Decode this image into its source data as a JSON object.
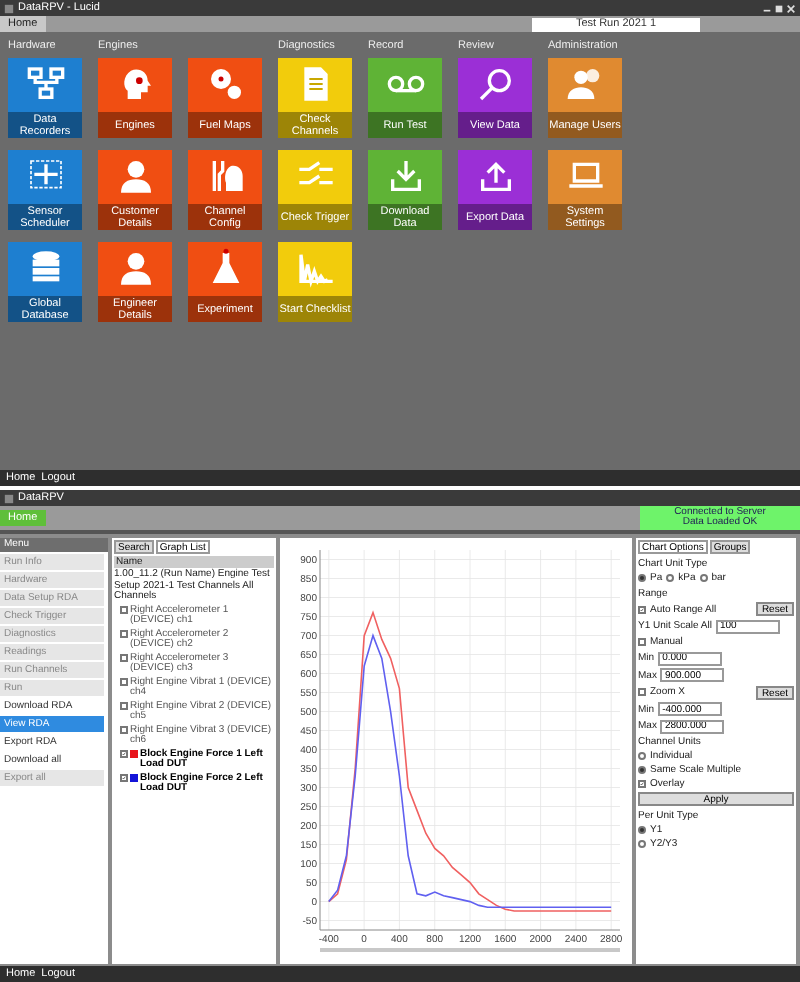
{
  "top_window": {
    "title": "DataRPV - Lucid",
    "tabs": [
      {
        "label": "Home",
        "selected": true
      }
    ],
    "search": {
      "value": "Test Run 2021 1"
    },
    "sections": [
      {
        "title": "Hardware",
        "tiles": [
          {
            "label": "Data Recorders",
            "color": "#1e7fd0"
          },
          {
            "label": "Sensor Scheduler",
            "color": "#1e7fd0"
          },
          {
            "label": "Global Database",
            "color": "#1e7fd0"
          }
        ]
      },
      {
        "title": "Engines",
        "tiles": [
          {
            "label": "Engines",
            "color": "#f04e12"
          },
          {
            "label": "Fuel Maps",
            "color": "#f04e12"
          },
          {
            "label": "Customer Details",
            "color": "#f04e12"
          },
          {
            "label": "Channel Config",
            "color": "#f04e12"
          },
          {
            "label": "Engineer Details",
            "color": "#f04e12"
          },
          {
            "label": "Experiment",
            "color": "#f04e12"
          }
        ]
      },
      {
        "title": "Diagnostics",
        "tiles": [
          {
            "label": "Check Channels",
            "color": "#f2cc0c"
          },
          {
            "label": "Check Trigger",
            "color": "#f2cc0c"
          },
          {
            "label": "Start Checklist",
            "color": "#f2cc0c"
          }
        ]
      },
      {
        "title": "Record",
        "tiles": [
          {
            "label": "Run Test",
            "color": "#5fb336"
          },
          {
            "label": "Download Data",
            "color": "#5fb336"
          }
        ]
      },
      {
        "title": "Review",
        "tiles": [
          {
            "label": "View Data",
            "color": "#9b2fd6"
          },
          {
            "label": "Export Data",
            "color": "#9b2fd6"
          }
        ]
      },
      {
        "title": "Administration",
        "tiles": [
          {
            "label": "Manage Users",
            "color": "#e08a30"
          },
          {
            "label": "System Settings",
            "color": "#e08a30"
          }
        ]
      }
    ],
    "status_bar": [
      "Home",
      "Logout"
    ]
  },
  "bottom_window": {
    "title": "DataRPV",
    "tabs": [
      {
        "label": "Home",
        "selected": true
      }
    ],
    "status_lines": [
      "Connected to Server",
      "Data Loaded OK"
    ],
    "sidebar": {
      "header": "Menu",
      "items": [
        {
          "label": "Run Info",
          "disabled": true,
          "selected": false
        },
        {
          "label": "Hardware",
          "disabled": true,
          "selected": false
        },
        {
          "label": "Data Setup RDA",
          "disabled": true,
          "selected": false
        },
        {
          "label": "Check Trigger",
          "disabled": true,
          "selected": false
        },
        {
          "label": "Diagnostics",
          "disabled": true,
          "selected": false
        },
        {
          "label": "Readings",
          "disabled": true,
          "selected": false
        },
        {
          "label": "Run Channels",
          "disabled": true,
          "selected": false
        },
        {
          "label": "Run",
          "disabled": true,
          "selected": false
        },
        {
          "label": "Download RDA",
          "disabled": false,
          "selected": false
        },
        {
          "label": "View RDA",
          "disabled": false,
          "selected": true
        },
        {
          "label": "Export RDA",
          "disabled": false,
          "selected": false
        },
        {
          "label": "Download all",
          "disabled": false,
          "selected": false
        },
        {
          "label": "Export all",
          "disabled": true,
          "selected": false
        }
      ]
    },
    "tree": {
      "tabs": [
        {
          "label": "Search",
          "selected": false
        },
        {
          "label": "Graph List",
          "selected": true
        }
      ],
      "header": "Name",
      "root": "1.00_11.2 (Run Name) Engine Test Setup 2021-1 Test Channels All Channels",
      "items": [
        {
          "label": "Right Accelerometer 1 (DEVICE) ch1",
          "checked": false
        },
        {
          "label": "Right Accelerometer 2 (DEVICE) ch2",
          "checked": false
        },
        {
          "label": "Right Accelerometer 3 (DEVICE) ch3",
          "checked": false
        },
        {
          "label": "Right Engine Vibrat 1 (DEVICE) ch4",
          "checked": false
        },
        {
          "label": "Right Engine Vibrat 2 (DEVICE) ch5",
          "checked": false
        },
        {
          "label": "Right Engine Vibrat 3 (DEVICE) ch6",
          "checked": false
        },
        {
          "label": "Block Engine Force 1 Left Load DUT",
          "checked": true,
          "color": "#e8141c"
        },
        {
          "label": "Block Engine Force 2 Left Load DUT",
          "checked": true,
          "color": "#1414d8"
        }
      ]
    },
    "chart": {
      "chart_data": {
        "type": "line",
        "x": [
          -400,
          -300,
          -200,
          -100,
          0,
          100,
          200,
          300,
          400,
          500,
          600,
          700,
          800,
          900,
          1000,
          1100,
          1200,
          1300,
          1400,
          1500,
          1600,
          1700,
          1800,
          1900,
          2000,
          2100,
          2200,
          2300,
          2400,
          2500,
          2600,
          2700,
          2800
        ],
        "series": [
          {
            "color": "#f06060",
            "values": [
              0,
              20,
              110,
              350,
              700,
              760,
              690,
              640,
              560,
              300,
              240,
              180,
              140,
              120,
              90,
              70,
              50,
              20,
              5,
              -10,
              -20,
              -25,
              -25,
              -25,
              -25,
              -25,
              -25,
              -25,
              -25,
              -25,
              -25,
              -25,
              -25
            ]
          },
          {
            "color": "#6060f0",
            "values": [
              0,
              30,
              120,
              330,
              620,
              700,
              640,
              500,
              330,
              120,
              20,
              15,
              25,
              15,
              10,
              5,
              0,
              -10,
              -15,
              -15,
              -15,
              -15,
              -15,
              -15,
              -15,
              -15,
              -15,
              -15,
              -15,
              -15,
              -15,
              -15,
              -15
            ]
          }
        ],
        "xlim": [
          -500,
          2900
        ],
        "ylim": [
          -75,
          925
        ],
        "grid": true,
        "xticks": [
          -400,
          0,
          400,
          800,
          1200,
          1600,
          2000,
          2400,
          2800
        ],
        "yticks": [
          -50,
          0,
          50,
          100,
          150,
          200,
          250,
          300,
          350,
          400,
          450,
          500,
          550,
          600,
          650,
          700,
          750,
          800,
          850,
          900
        ]
      }
    },
    "options": {
      "tabs": [
        {
          "label": "Chart Options",
          "selected": true
        },
        {
          "label": "Groups",
          "selected": false
        }
      ],
      "unit_type": {
        "title": "Chart Unit Type",
        "options": [
          {
            "label": "Pa",
            "selected": true
          },
          {
            "label": "kPa",
            "selected": false
          },
          {
            "label": "bar",
            "selected": false
          }
        ]
      },
      "range": {
        "title": "Range",
        "auto_label": "Auto Range All",
        "auto_checked": true,
        "reset": "Reset",
        "scale_label": "Y1 Unit Scale All",
        "scale_value": "100",
        "manual_label": "Manual",
        "manual_checked": false,
        "min_label": "Min",
        "min_value": "0.000",
        "max_label": "Max",
        "max_value": "900.000"
      },
      "zoom": {
        "label": "Zoom X",
        "checked": false,
        "reset": "Reset",
        "min_label": "Min",
        "min_value": "-400.000",
        "max_label": "Max",
        "max_value": "2800.000"
      },
      "channel_units": {
        "title": "Channel Units",
        "options": [
          {
            "label": "Individual",
            "selected": false
          },
          {
            "label": "Same Scale Multiple",
            "selected": true
          }
        ],
        "overlay_label": "Overlay",
        "overlay_checked": true,
        "apply": "Apply"
      },
      "per_unit": {
        "title": "Per Unit Type",
        "options": [
          {
            "label": "Y1",
            "selected": true
          },
          {
            "label": "Y2/Y3",
            "selected": false
          }
        ]
      }
    },
    "status_bar": [
      "Home",
      "Logout"
    ]
  }
}
